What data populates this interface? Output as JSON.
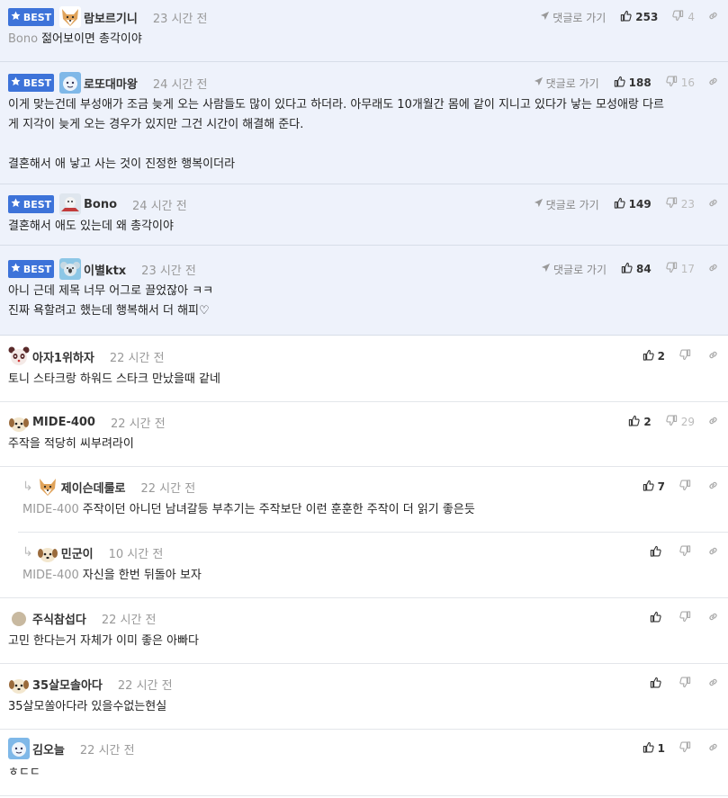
{
  "best_label": "BEST",
  "reply_link": "댓글로 가기",
  "comments": [
    {
      "best": true,
      "user": "람보르기니",
      "avatar": "shiba",
      "time": "23 시간 전",
      "lines": [
        {
          "ref": "Bono",
          "text": "젊어보이면 총각이야"
        }
      ],
      "up": "253",
      "down": "4",
      "show_reply": true
    },
    {
      "best": true,
      "user": "로또대마왕",
      "avatar": "blue",
      "time": "24 시간 전",
      "lines": [
        {
          "ref": "",
          "text": "이게 맞는건데 부성애가 조금 늦게 오는 사람들도 많이 있다고 하더라. 아무래도 10개월간 몸에 같이 지니고 있다가 낳는 모성애랑 다르"
        },
        {
          "ref": "",
          "text": "게 지각이 늦게 오는 경우가 있지만 그건 시간이 해결해 준다."
        },
        {
          "ref": "",
          "text": ""
        },
        {
          "ref": "",
          "text": "결혼해서 애 낳고 사는 것이 진정한 행복이더라"
        }
      ],
      "up": "188",
      "down": "16",
      "show_reply": true
    },
    {
      "best": true,
      "user": "Bono",
      "avatar": "car",
      "time": "24 시간 전",
      "lines": [
        {
          "ref": "",
          "text": "결혼해서 애도 있는데 왜 총각이야"
        }
      ],
      "up": "149",
      "down": "23",
      "show_reply": true
    },
    {
      "best": true,
      "user": "이별ktx",
      "avatar": "koala",
      "time": "23 시간 전",
      "lines": [
        {
          "ref": "",
          "text": "아니 근데 제목 너무 어그로 끌었잖아 ㅋㅋ"
        },
        {
          "ref": "",
          "text": "진짜 욕할려고 했는데 행복해서 더 해피♡"
        }
      ],
      "up": "84",
      "down": "17",
      "show_reply": true
    },
    {
      "best": false,
      "reply": false,
      "user": "아자1위하자",
      "avatar": "panda",
      "time": "22 시간 전",
      "lines": [
        {
          "ref": "",
          "text": "토니 스타크랑 하워드 스타크 만났을때 같네"
        }
      ],
      "up": "2",
      "down": "",
      "show_reply": false
    },
    {
      "best": false,
      "reply": false,
      "user": "MIDE-400",
      "avatar": "dog",
      "time": "22 시간 전",
      "lines": [
        {
          "ref": "",
          "text": "주작을 적당히 씨부려라이"
        }
      ],
      "up": "2",
      "down": "29",
      "show_reply": false
    },
    {
      "best": false,
      "reply": true,
      "user": "제이슨데룰로",
      "avatar": "shiba",
      "time": "22 시간 전",
      "lines": [
        {
          "ref": "MIDE-400",
          "text": "주작이던 아니던 남녀갈등 부추기는 주작보단 이런 훈훈한 주작이 더 읽기 좋은듯"
        }
      ],
      "up": "7",
      "down": "",
      "show_reply": false
    },
    {
      "best": false,
      "reply": true,
      "user": "민군이",
      "avatar": "dog",
      "time": "10 시간 전",
      "lines": [
        {
          "ref": "MIDE-400",
          "text": "자신을 한번 뒤돌아 보자"
        }
      ],
      "up": "",
      "down": "",
      "show_reply": false
    },
    {
      "best": false,
      "reply": false,
      "user": "주식참섭다",
      "avatar": "circle",
      "time": "22 시간 전",
      "lines": [
        {
          "ref": "",
          "text": "고민 한다는거 자체가 이미 좋은 아빠다"
        }
      ],
      "up": "",
      "down": "",
      "show_reply": false
    },
    {
      "best": false,
      "reply": false,
      "user": "35살모솔아다",
      "avatar": "dog",
      "time": "22 시간 전",
      "lines": [
        {
          "ref": "",
          "text": "35살모쏠아다라 있을수없는현실"
        }
      ],
      "up": "",
      "down": "",
      "show_reply": false
    },
    {
      "best": false,
      "reply": false,
      "user": "김오늘",
      "avatar": "blue",
      "time": "22 시간 전",
      "lines": [
        {
          "ref": "",
          "text": "ㅎㄷㄷ"
        }
      ],
      "up": "1",
      "down": "",
      "show_reply": false
    }
  ]
}
